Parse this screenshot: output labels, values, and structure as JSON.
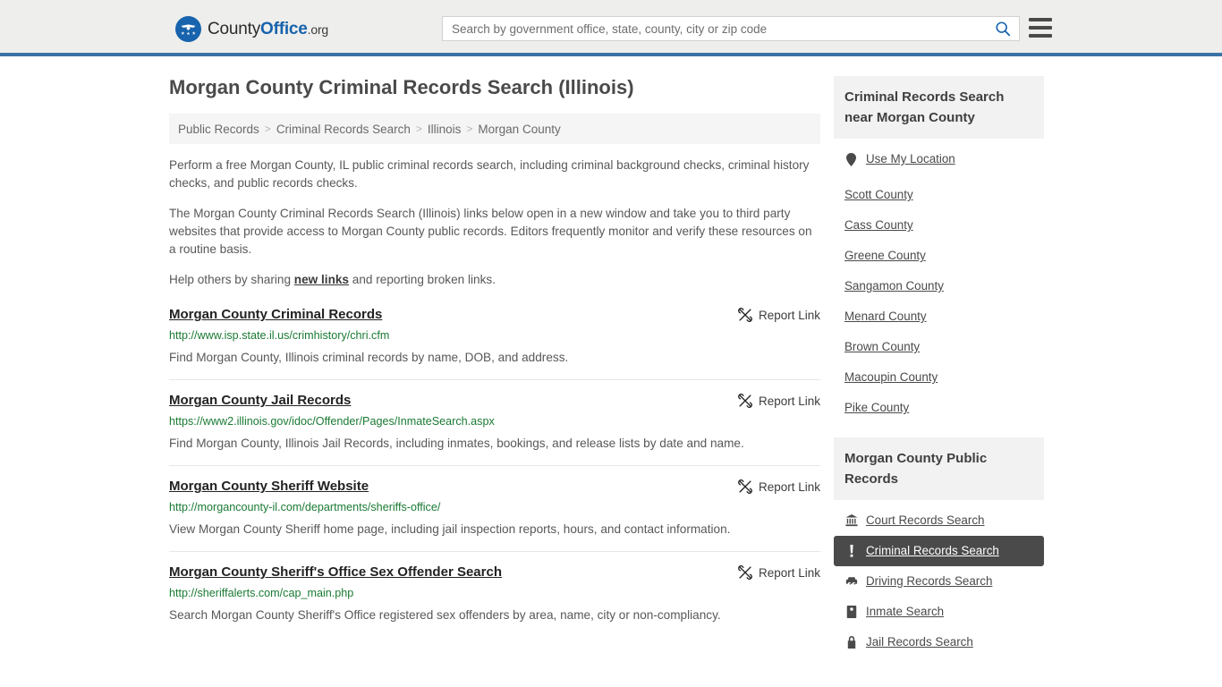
{
  "header": {
    "logo": {
      "icon": "eagle-shield-logo",
      "text_first": "County",
      "text_bold": "Office",
      "text_suffix": ".org"
    },
    "search": {
      "placeholder": "Search by government office, state, county, city or zip code",
      "value": "",
      "icon": "search-icon"
    },
    "menu_icon": "hamburger-menu-icon",
    "accent_color": "#3a72a8",
    "background_color": "#eeeeec"
  },
  "page": {
    "title": "Morgan County Criminal Records Search (Illinois)"
  },
  "breadcrumb": {
    "separator": ">",
    "items": [
      {
        "label": "Public Records"
      },
      {
        "label": "Criminal Records Search"
      },
      {
        "label": "Illinois"
      },
      {
        "label": "Morgan County"
      }
    ]
  },
  "intro": {
    "p1": "Perform a free Morgan County, IL public criminal records search, including criminal background checks, criminal history checks, and public records checks.",
    "p2": "The Morgan County Criminal Records Search (Illinois) links below open in a new window and take you to third party websites that provide access to Morgan County public records. Editors frequently monitor and verify these resources on a routine basis.",
    "p3_before": "Help others by sharing ",
    "p3_link": "new links",
    "p3_after": " and reporting broken links."
  },
  "results": {
    "report_label": "Report Link",
    "report_icon": "broken-link-icon",
    "items": [
      {
        "title": "Morgan County Criminal Records",
        "url": "http://www.isp.state.il.us/crimhistory/chri.cfm",
        "description": "Find Morgan County, Illinois criminal records by name, DOB, and address."
      },
      {
        "title": "Morgan County Jail Records",
        "url": "https://www2.illinois.gov/idoc/Offender/Pages/InmateSearch.aspx",
        "description": "Find Morgan County, Illinois Jail Records, including inmates, bookings, and release lists by date and name."
      },
      {
        "title": "Morgan County Sheriff Website",
        "url": "http://morgancounty-il.com/departments/sheriffs-office/",
        "description": "View Morgan County Sheriff home page, including jail inspection reports, hours, and contact information."
      },
      {
        "title": "Morgan County Sheriff's Office Sex Offender Search",
        "url": "http://sheriffalerts.com/cap_main.php",
        "description": "Search Morgan County Sheriff's Office registered sex offenders by area, name, city or non-compliancy."
      }
    ]
  },
  "sidebar": {
    "nearby": {
      "heading": "Criminal Records Search near Morgan County",
      "use_my_location": {
        "label": "Use My Location",
        "icon": "map-pin-icon"
      },
      "counties": [
        {
          "label": "Scott County"
        },
        {
          "label": "Cass County"
        },
        {
          "label": "Greene County"
        },
        {
          "label": "Sangamon County"
        },
        {
          "label": "Menard County"
        },
        {
          "label": "Brown County"
        },
        {
          "label": "Macoupin County"
        },
        {
          "label": "Pike County"
        }
      ]
    },
    "public_records": {
      "heading": "Morgan County Public Records",
      "active_color": "#4a4a4a",
      "items": [
        {
          "label": "Court Records Search",
          "icon": "courthouse-icon",
          "active": false
        },
        {
          "label": "Criminal Records Search",
          "icon": "exclamation-icon",
          "active": true
        },
        {
          "label": "Driving Records Search",
          "icon": "car-icon",
          "active": false
        },
        {
          "label": "Inmate Search",
          "icon": "id-card-icon",
          "active": false
        },
        {
          "label": "Jail Records Search",
          "icon": "lock-icon",
          "active": false
        }
      ]
    }
  }
}
